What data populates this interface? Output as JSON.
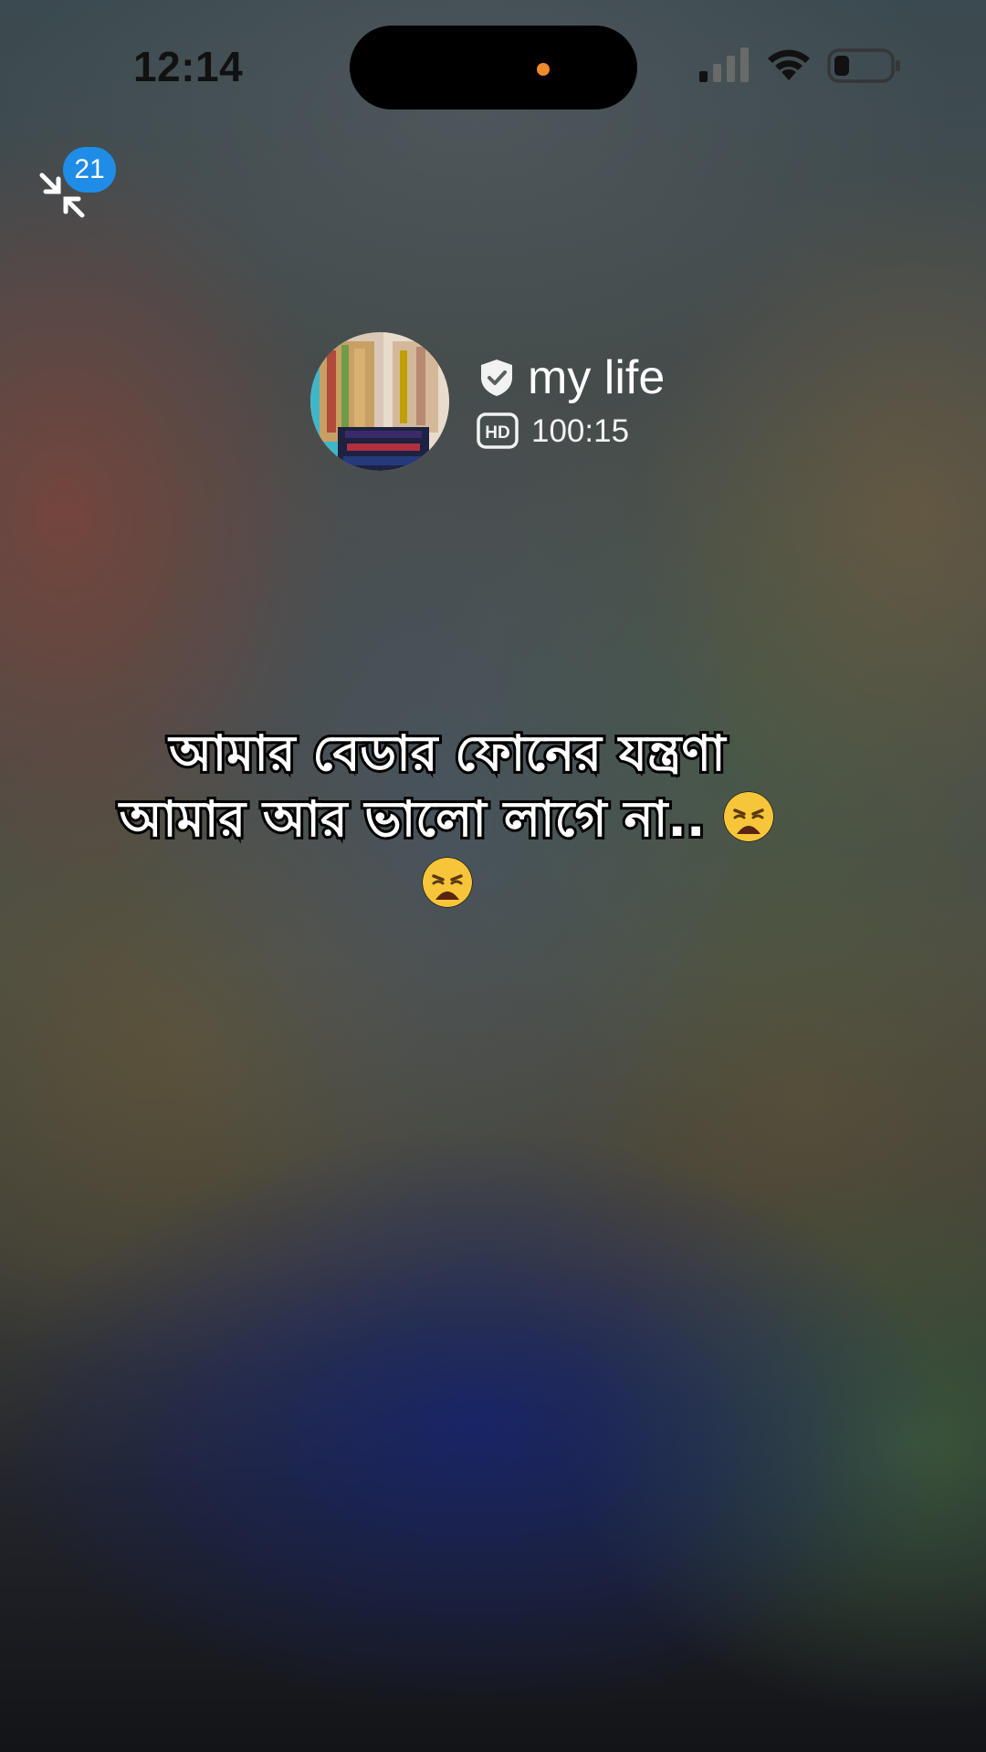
{
  "status_bar": {
    "time": "12:14",
    "signal_icon": "cellular-signal-icon",
    "wifi_icon": "wifi-icon",
    "battery_icon": "battery-low-icon",
    "privacy_indicator_color": "#f08a2c"
  },
  "minimize": {
    "icon": "minimize-arrows-icon",
    "badge_count": "21",
    "badge_color": "#1f8ce8"
  },
  "caller": {
    "name": "my life",
    "verified_icon": "shield-check-icon",
    "quality_icon": "hd-badge-icon",
    "call_duration": "100:15"
  },
  "caption": {
    "line1": "আমার বেডার ফোনের যন্ত্রণা",
    "line2": "আমার আর ভালো লাগে না..",
    "emoji_icon": "weary-face-emoji-icon"
  }
}
